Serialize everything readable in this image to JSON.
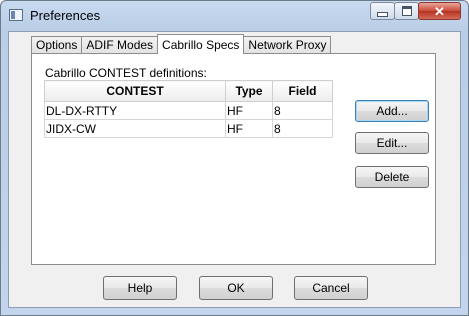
{
  "window": {
    "title": "Preferences"
  },
  "tabs": [
    {
      "label": "Options"
    },
    {
      "label": "ADIF Modes"
    },
    {
      "label": "Cabrillo Specs",
      "active": true
    },
    {
      "label": "Network Proxy"
    }
  ],
  "panel": {
    "group_label": "Cabrillo CONTEST definitions:",
    "columns": [
      "CONTEST",
      "Type",
      "Field"
    ],
    "rows": [
      {
        "contest": "DL-DX-RTTY",
        "type": "HF",
        "field": "8"
      },
      {
        "contest": "JIDX-CW",
        "type": "HF",
        "field": "8"
      }
    ],
    "buttons": {
      "add": "Add...",
      "edit": "Edit...",
      "delete": "Delete"
    }
  },
  "footer": {
    "help": "Help",
    "ok": "OK",
    "cancel": "Cancel"
  },
  "icons": {
    "app": "window-icon",
    "minimize": "minimize-icon",
    "maximize": "maximize-icon",
    "close": "close-icon"
  }
}
